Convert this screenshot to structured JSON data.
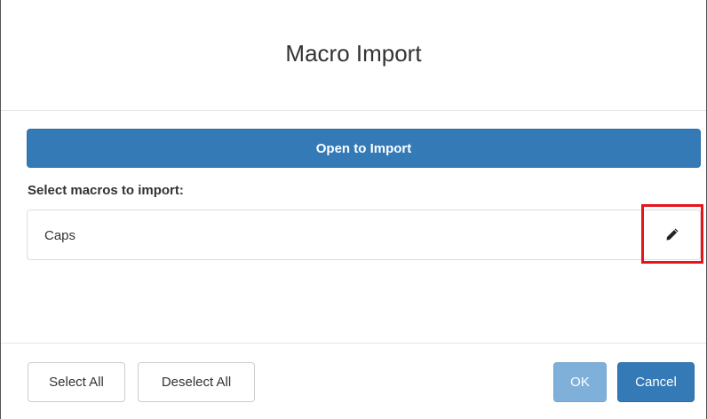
{
  "dialog": {
    "title": "Macro Import"
  },
  "open_button": {
    "label": "Open to Import"
  },
  "select_label": "Select macros to import:",
  "macros": [
    {
      "name": "Caps",
      "action_icon": "pencil-icon"
    }
  ],
  "footer": {
    "select_all_label": "Select All",
    "deselect_all_label": "Deselect All",
    "ok_label": "OK",
    "cancel_label": "Cancel"
  },
  "colors": {
    "primary": "#337ab7",
    "primary_disabled": "#7fb0d9",
    "highlight": "#e8141c"
  }
}
